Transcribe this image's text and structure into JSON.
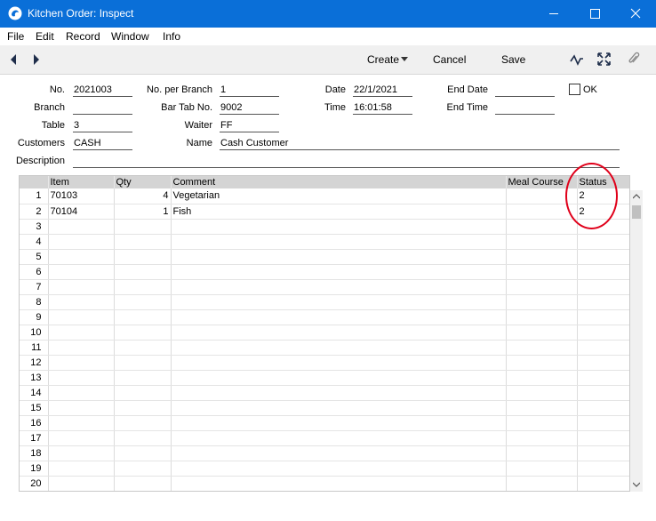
{
  "window": {
    "title": "Kitchen Order: Inspect"
  },
  "menu": [
    "File",
    "Edit",
    "Record",
    "Window",
    "Info"
  ],
  "toolbar": {
    "create": "Create",
    "cancel": "Cancel",
    "save": "Save"
  },
  "header": {
    "no_label": "No.",
    "no_value": "2021003",
    "no_per_branch_label": "No. per Branch",
    "no_per_branch_value": "1",
    "date_label": "Date",
    "date_value": "22/1/2021",
    "end_date_label": "End Date",
    "end_date_value": "",
    "ok_label": "OK",
    "branch_label": "Branch",
    "branch_value": "",
    "bar_tab_label": "Bar Tab No.",
    "bar_tab_value": "9002",
    "time_label": "Time",
    "time_value": "16:01:58",
    "end_time_label": "End Time",
    "end_time_value": "",
    "table_label": "Table",
    "table_value": "3",
    "waiter_label": "Waiter",
    "waiter_value": "FF",
    "customers_label": "Customers",
    "customers_value": "CASH",
    "name_label": "Name",
    "name_value": "Cash Customer",
    "description_label": "Description",
    "description_value": ""
  },
  "grid": {
    "columns": [
      "Item",
      "Qty",
      "Comment",
      "Meal Course",
      "Status"
    ],
    "rows": [
      {
        "n": "1",
        "item": "70103",
        "qty": "4",
        "comment": "Vegetarian",
        "meal": "",
        "status": "2"
      },
      {
        "n": "2",
        "item": "70104",
        "qty": "1",
        "comment": "Fish",
        "meal": "",
        "status": "2"
      },
      {
        "n": "3"
      },
      {
        "n": "4"
      },
      {
        "n": "5"
      },
      {
        "n": "6"
      },
      {
        "n": "7"
      },
      {
        "n": "8"
      },
      {
        "n": "9"
      },
      {
        "n": "10"
      },
      {
        "n": "11"
      },
      {
        "n": "12"
      },
      {
        "n": "13"
      },
      {
        "n": "14"
      },
      {
        "n": "15"
      },
      {
        "n": "16"
      },
      {
        "n": "17"
      },
      {
        "n": "18"
      },
      {
        "n": "19"
      },
      {
        "n": "20"
      }
    ]
  },
  "colors": {
    "titlebar": "#0a6fd8",
    "annotation": "#e0001a"
  },
  "icons": [
    "app-icon",
    "minimize-icon",
    "maximize-icon",
    "close-icon",
    "back-arrow-icon",
    "forward-arrow-icon",
    "dropdown-caret-icon",
    "activity-icon",
    "expand-icon",
    "paperclip-icon"
  ]
}
